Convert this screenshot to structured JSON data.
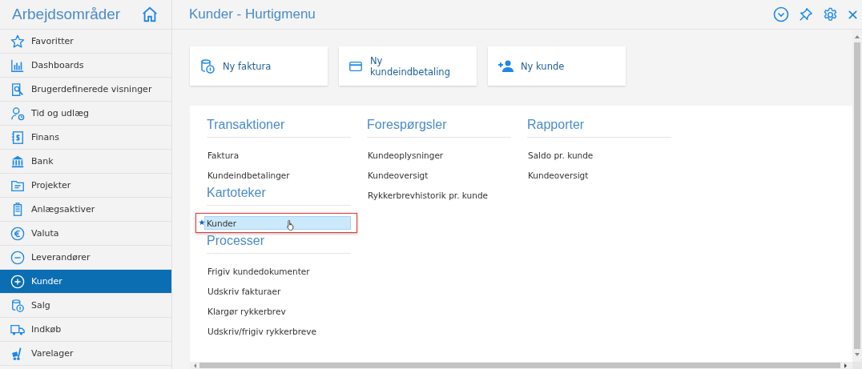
{
  "sidebar": {
    "title": "Arbejdsområder",
    "items": [
      {
        "label": "Favoritter",
        "selected": false
      },
      {
        "label": "Dashboards",
        "selected": false
      },
      {
        "label": "Brugerdefinerede visninger",
        "selected": false
      },
      {
        "label": "Tid og udlæg",
        "selected": false
      },
      {
        "label": "Finans",
        "selected": false
      },
      {
        "label": "Bank",
        "selected": false
      },
      {
        "label": "Projekter",
        "selected": false
      },
      {
        "label": "Anlægsaktiver",
        "selected": false
      },
      {
        "label": "Valuta",
        "selected": false
      },
      {
        "label": "Leverandører",
        "selected": false
      },
      {
        "label": "Kunder",
        "selected": true
      },
      {
        "label": "Salg",
        "selected": false
      },
      {
        "label": "Indkøb",
        "selected": false
      },
      {
        "label": "Varelager",
        "selected": false
      }
    ]
  },
  "page": {
    "title": "Kunder - Hurtigmenu"
  },
  "quick_actions": [
    {
      "label": "Ny faktura"
    },
    {
      "label": "Ny kundeindbetaling"
    },
    {
      "label": "Ny kunde"
    }
  ],
  "menu_columns": [
    {
      "sections": [
        {
          "title": "Transaktioner",
          "items": [
            {
              "label": "Faktura",
              "selected": false,
              "favorite": false,
              "outlined": false
            },
            {
              "label": "Kundeindbetalinger",
              "selected": false,
              "favorite": false,
              "outlined": false
            }
          ]
        },
        {
          "title": "Kartoteker",
          "items": [
            {
              "label": "Kunder",
              "selected": true,
              "favorite": true,
              "outlined": true
            }
          ]
        },
        {
          "title": "Processer",
          "items": [
            {
              "label": "Frigiv kundedokumenter",
              "selected": false,
              "favorite": false,
              "outlined": false
            },
            {
              "label": "Udskriv fakturaer",
              "selected": false,
              "favorite": false,
              "outlined": false
            },
            {
              "label": "Klargør rykkerbrev",
              "selected": false,
              "favorite": false,
              "outlined": false
            },
            {
              "label": "Udskriv/frigiv rykkerbreve",
              "selected": false,
              "favorite": false,
              "outlined": false
            }
          ]
        }
      ]
    },
    {
      "sections": [
        {
          "title": "Forespørgsler",
          "items": [
            {
              "label": "Kundeoplysninger",
              "selected": false,
              "favorite": false,
              "outlined": false
            },
            {
              "label": "Kundeoversigt",
              "selected": false,
              "favorite": false,
              "outlined": false
            },
            {
              "label": "Rykkerbrevhistorik pr. kunde",
              "selected": false,
              "favorite": false,
              "outlined": false
            }
          ]
        }
      ]
    },
    {
      "sections": [
        {
          "title": "Rapporter",
          "items": [
            {
              "label": "Saldo pr. kunde",
              "selected": false,
              "favorite": false,
              "outlined": false
            },
            {
              "label": "Kundeoversigt",
              "selected": false,
              "favorite": false,
              "outlined": false
            }
          ]
        }
      ]
    }
  ]
}
